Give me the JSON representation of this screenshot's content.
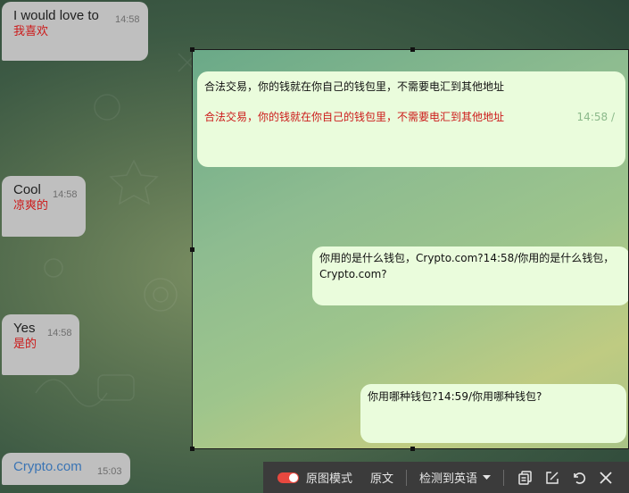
{
  "chat": {
    "messages": [
      {
        "text": "I would love to",
        "translation": "我喜欢",
        "time": "14:58"
      },
      {
        "text": "Cool",
        "translation": "凉爽的",
        "time": "14:58"
      },
      {
        "text": "Yes",
        "translation": "是的",
        "time": "14:58"
      },
      {
        "text": "Crypto.com",
        "time": "15:03"
      }
    ]
  },
  "overlay": {
    "bubbles": [
      {
        "original": "合法交易，你的钱就在你自己的钱包里，不需要电汇到其他地址",
        "translation": "合法交易，你的钱就在你自己的钱包里，不需要电汇到其他地址",
        "time_fragment": "14:58 /"
      },
      {
        "text": "你用的是什么钱包，Crypto.com?14:58/你用的是什么钱包，Crypto.com?"
      },
      {
        "text": "你用哪种钱包?14:59/你用哪种钱包?"
      }
    ]
  },
  "toolbar": {
    "original_mode_label": "原图模式",
    "original_text_label": "原文",
    "detected_language_label": "检测到英语",
    "toggle_on": true,
    "colors": {
      "toggle": "#e8483f",
      "background": "#3b3b3b"
    }
  }
}
